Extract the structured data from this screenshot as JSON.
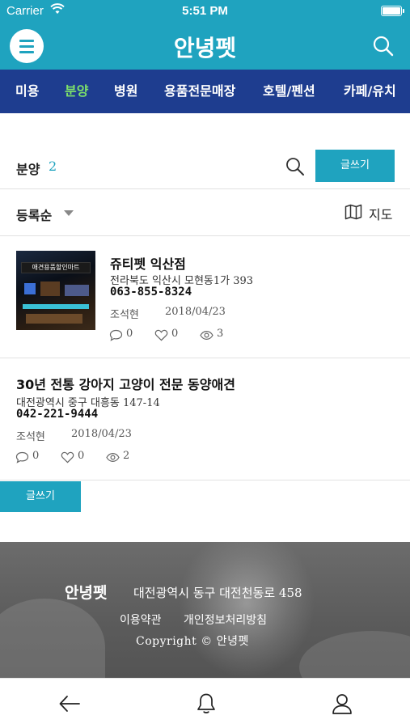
{
  "status_bar": {
    "carrier": "Carrier",
    "time": "5:51 PM"
  },
  "header": {
    "title": "안녕펫"
  },
  "categories": [
    {
      "label": "미용",
      "active": false
    },
    {
      "label": "분양",
      "active": true
    },
    {
      "label": "병원",
      "active": false
    },
    {
      "label": "용품전문매장",
      "active": false
    },
    {
      "label": "호텔/펜션",
      "active": false
    },
    {
      "label": "카페/유치",
      "active": false
    }
  ],
  "list": {
    "title": "분양",
    "count": "2",
    "write_label": "글쓰기",
    "sort_label": "등록순",
    "map_label": "지도"
  },
  "items": [
    {
      "title": "쥬티펫 익산점",
      "address": "전라북도 익산시 모현동1가 393",
      "phone": "063-855-8324",
      "author": "조석현",
      "date": "2018/04/23",
      "comments": "0",
      "likes": "0",
      "views": "3",
      "thumb_sign": "애견용품할인마트"
    },
    {
      "title": "30년 전통 강아지 고양이 전문 동양애견",
      "address": "대전광역시 중구 대흥동 147-14",
      "phone": "042-221-9444",
      "author": "조석현",
      "date": "2018/04/23",
      "comments": "0",
      "likes": "0",
      "views": "2"
    }
  ],
  "footer": {
    "brand": "안녕펫",
    "address": "대전광역시 동구 대전천동로 458",
    "terms": "이용약관",
    "privacy": "개인정보처리방침",
    "copyright": "Copyright © 안녕펫"
  },
  "colors": {
    "accent": "#1fa3bf",
    "nav": "#1e3d8f",
    "active_category": "#7ee36a"
  },
  "icons": [
    "menu-icon",
    "search-icon",
    "map-icon",
    "comment-icon",
    "heart-icon",
    "eye-icon",
    "back-arrow-icon",
    "bell-icon",
    "user-icon"
  ]
}
